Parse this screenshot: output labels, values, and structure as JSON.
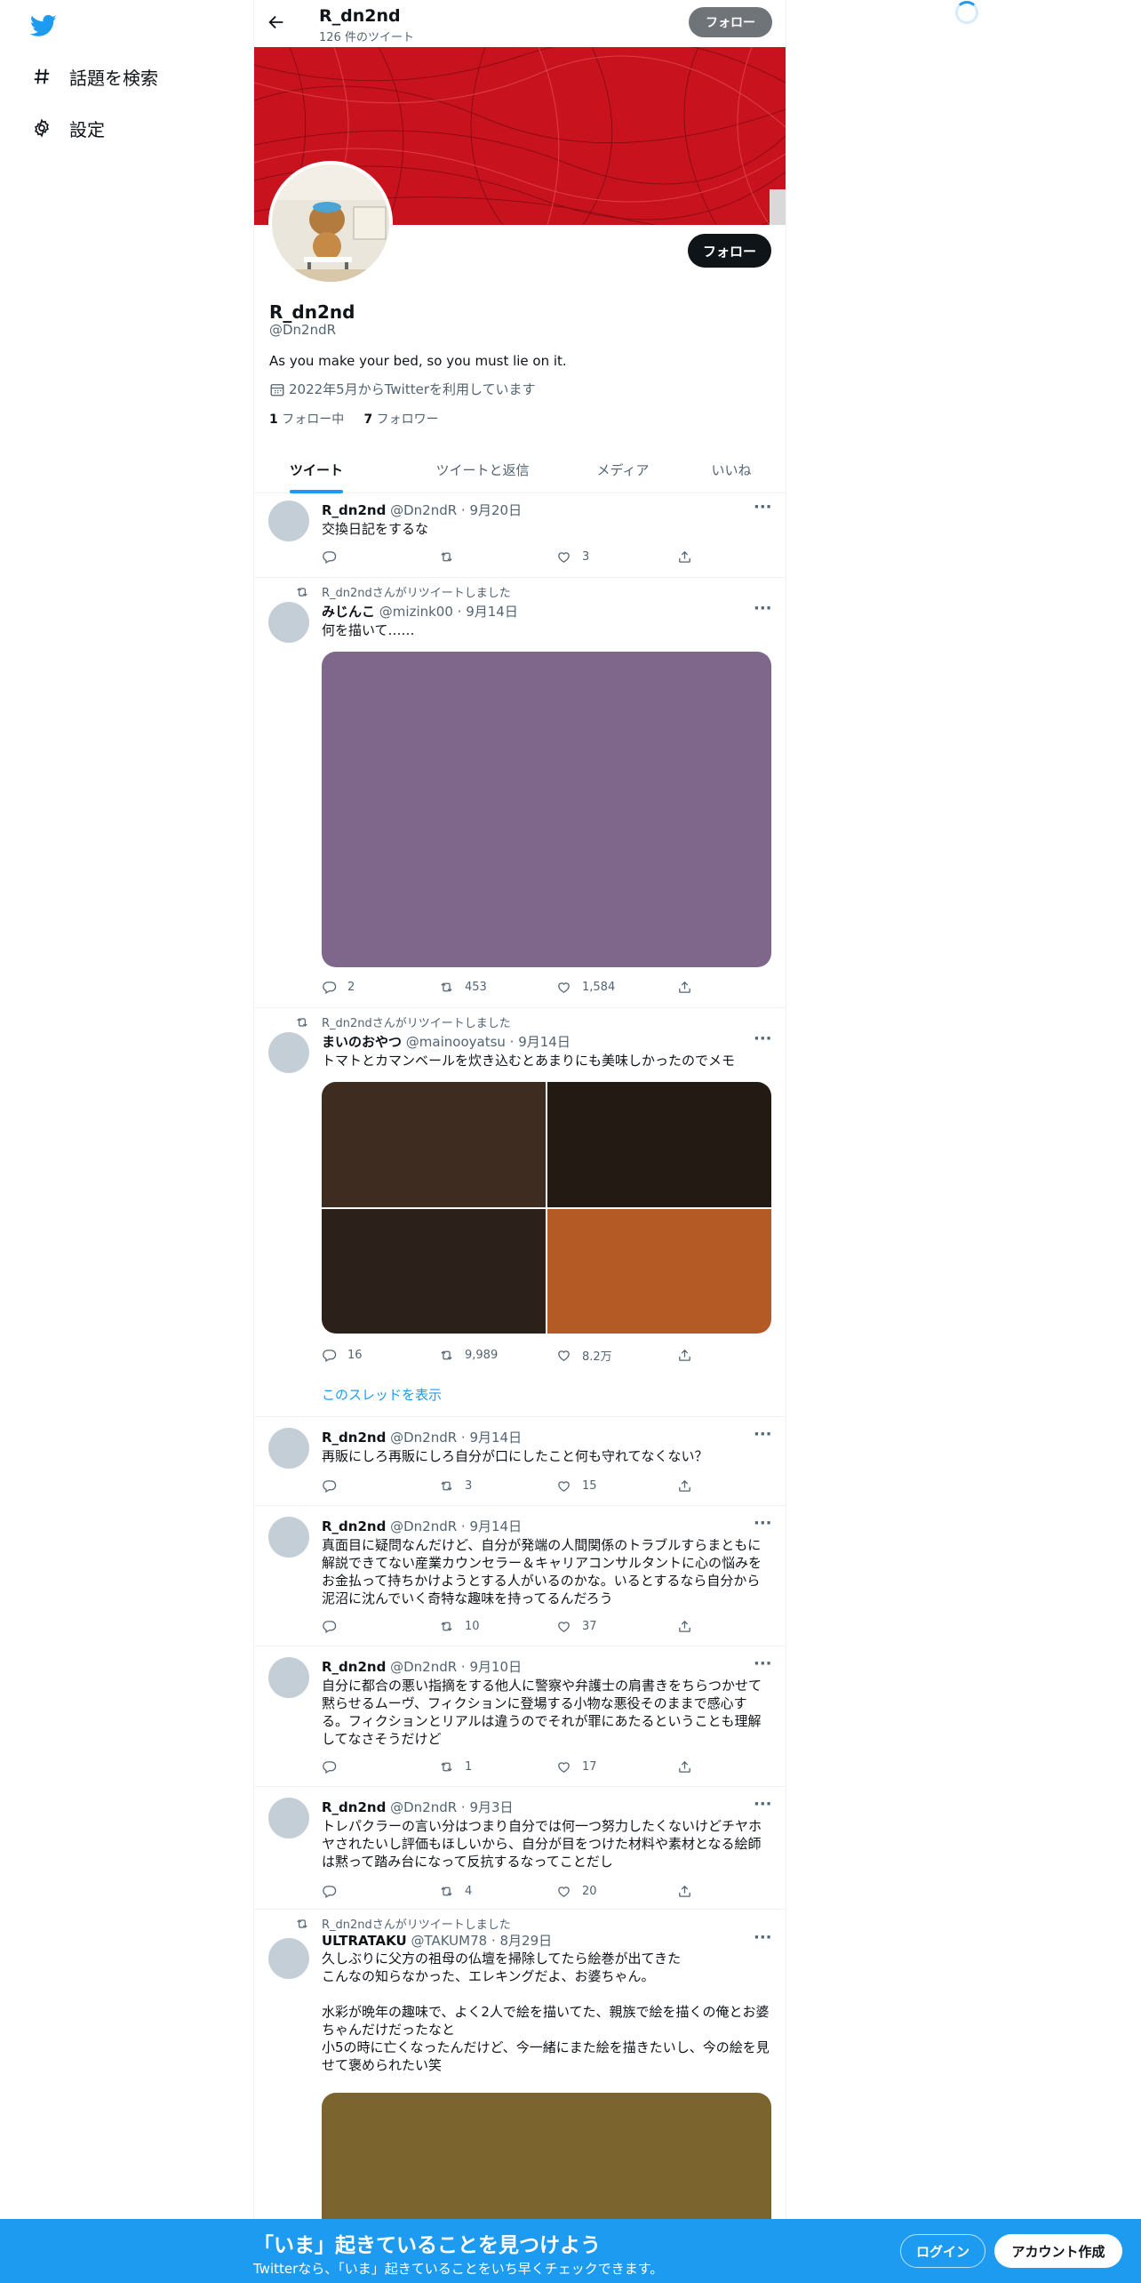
{
  "nav": {
    "items": [
      {
        "label": "話題を検索",
        "icon": "hashtag-icon"
      },
      {
        "label": "設定",
        "icon": "gear-icon"
      }
    ]
  },
  "topbar": {
    "name": "R_dn2nd",
    "tweet_count": "126 件のツイート",
    "follow_label": "フォロー"
  },
  "profile": {
    "name": "R_dn2nd",
    "handle": "@Dn2ndR",
    "bio": "As you make your bed, so you must lie on it.",
    "joined": "2022年5月からTwitterを利用しています",
    "following_count": "1",
    "following_label": "フォロー中",
    "followers_count": "7",
    "followers_label": "フォロワー",
    "follow_label": "フォロー",
    "banner_color": "#c8131f"
  },
  "tabs": [
    {
      "label": "ツイート",
      "active": true
    },
    {
      "label": "ツイートと返信",
      "active": false
    },
    {
      "label": "メディア",
      "active": false
    },
    {
      "label": "いいね",
      "active": false
    }
  ],
  "tweets": [
    {
      "name": "R_dn2nd",
      "meta": "@Dn2ndR · 9月20日",
      "text": "交換日記をするな",
      "reply": "",
      "retweet": "",
      "like": "3"
    },
    {
      "retweeted_by": "R_dn2ndさんがリツイートしました",
      "name": "みじんこ",
      "meta": "@mizink00 · 9月14日",
      "text": "何を描いて……",
      "media_color": "#7f678b",
      "reply": "2",
      "retweet": "453",
      "like": "1,584"
    },
    {
      "retweeted_by": "R_dn2ndさんがリツイートしました",
      "name": "まいのおやつ",
      "meta": "@mainooyatsu · 9月14日",
      "text": "トマトとカマンベールを炊き込むとあまりにも美味しかったのでメモ",
      "media_colors": [
        "#3d2c1f",
        "#231a13",
        "#2b201a",
        "#b45a24"
      ],
      "reply": "16",
      "retweet": "9,989",
      "like": "8.2万",
      "thread_link": "このスレッドを表示"
    },
    {
      "name": "R_dn2nd",
      "meta": "@Dn2ndR · 9月14日",
      "text": "再販にしろ再販にしろ自分が口にしたこと何も守れてなくない？",
      "reply": "",
      "retweet": "3",
      "like": "15"
    },
    {
      "name": "R_dn2nd",
      "meta": "@Dn2ndR · 9月14日",
      "text": "真面目に疑問なんだけど、自分が発端の人間関係のトラブルすらまともに\n解説できてない産業カウンセラー＆キャリアコンサルタントに心の悩みを\nお金払って持ちかけようとする人がいるのかな。いるとするなら自分から\n泥沼に沈んでいく奇特な趣味を持ってるんだろう",
      "reply": "",
      "retweet": "10",
      "like": "37"
    },
    {
      "name": "R_dn2nd",
      "meta": "@Dn2ndR · 9月10日",
      "text": "自分に都合の悪い指摘をする他人に警察や弁護士の肩書きをちらつかせて\n黙らせるムーヴ、フィクションに登場する小物な悪役そのままで感心す\nる。フィクションとリアルは違うのでそれが罪にあたるということも理解\nしてなさそうだけど",
      "reply": "",
      "retweet": "1",
      "like": "17"
    },
    {
      "name": "R_dn2nd",
      "meta": "@Dn2ndR · 9月3日",
      "text": "トレパクラーの言い分はつまり自分では何一つ努力したくないけどチヤホ\nヤされたいし評価もほしいから、自分が目をつけた材料や素材となる絵師\nは黙って踏み台になって反抗するなってことだし",
      "reply": "",
      "retweet": "4",
      "like": "20"
    },
    {
      "retweeted_by": "R_dn2ndさんがリツイートしました",
      "name": "ULTRATAKU",
      "meta": "@TAKUM78 · 8月29日",
      "text": "久しぶりに父方の祖母の仏壇を掃除してたら絵巻が出てきた\nこんなの知らなかった、エレキングだよ、お婆ちゃん。\n\n水彩が晩年の趣味で、よく2人で絵を描いてた、親族で絵を描くの俺とお婆\nちゃんだけだったなと\n小5の時に亡くなったんだけど、今一緒にまた絵を描きたいし、今の絵を見\nせて褒められたい笑",
      "media_color": "#7b642e"
    }
  ],
  "bottombar": {
    "title": "「いま」起きていることを見つけよう",
    "subtitle": "Twitterなら、「いま」起きていることをいち早くチェックできます。",
    "login": "ログイン",
    "signup": "アカウント作成",
    "color": "#1d9bf0"
  }
}
